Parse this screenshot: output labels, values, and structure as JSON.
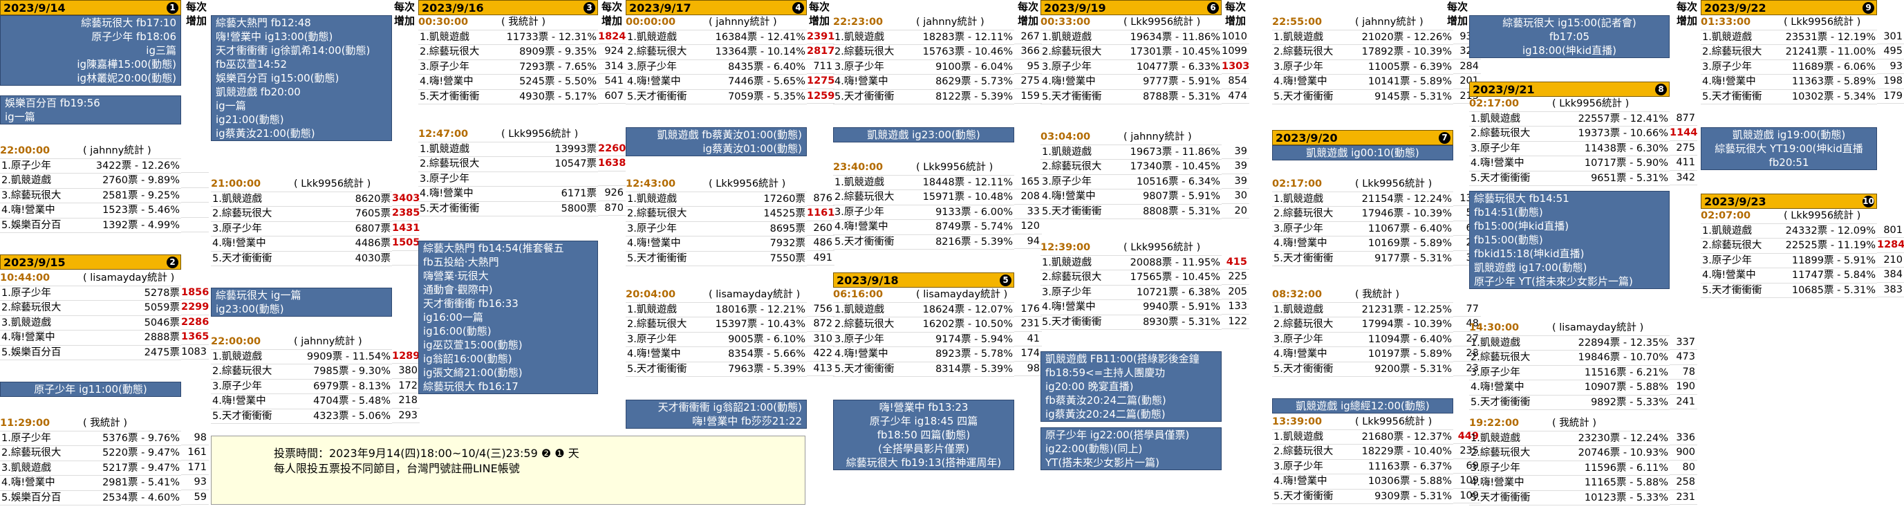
{
  "col_inc_header": "每次增加",
  "days": [
    {
      "date": "2023/9/14",
      "num": "1",
      "blue": [
        "綜藝玩很大 fb17:10",
        "原子少年 fb18:06",
        "ig三篇",
        "ig陳嘉樺15:00(動態)",
        "ig林叢妮20:00(動態)"
      ],
      "blue2": [
        "娛樂百分百 fb19:56",
        "ig一篇"
      ],
      "stats": [
        {
          "time": "22:00:00",
          "src": "( jahnny統計 )",
          "rows": [
            [
              "1.原子少年",
              "3422票 - 12.26%"
            ],
            [
              "2.凱競遊戲",
              "2760票 - 9.89%"
            ],
            [
              "3.綜藝玩很大",
              "2581票 - 9.25%"
            ],
            [
              "4.嗨!營業中",
              "1523票 - 5.46%"
            ],
            [
              "5.娛樂百分百",
              "1392票 - 4.99%"
            ]
          ],
          "inc": [
            "",
            "",
            "",
            "",
            ""
          ]
        }
      ]
    },
    {
      "date": "2023/9/15",
      "num": "2",
      "stats": [
        {
          "time": "10:44:00",
          "src": "( lisamayday統計 )",
          "rows": [
            [
              "1.原子少年",
              "5278票"
            ],
            [
              "2.綜藝玩很大",
              "5059票"
            ],
            [
              "3.凱競遊戲",
              "5046票"
            ],
            [
              "4.嗨!營業中",
              "2888票"
            ],
            [
              "5.娛樂百分百",
              "2475票"
            ]
          ],
          "inc": [
            "1856",
            "2299",
            "2286",
            "1365",
            "1083"
          ]
        },
        {
          "time": "11:29:00",
          "src": "( 我統計 )",
          "rows": [
            [
              "1.原子少年",
              "5376票 - 9.76%"
            ],
            [
              "2.綜藝玩很大",
              "5220票 - 9.47%"
            ],
            [
              "3.凱競遊戲",
              "5217票 - 9.47%"
            ],
            [
              "4.嗨!營業中",
              "2981票 - 5.41%"
            ],
            [
              "5.娛樂百分百",
              "2534票 - 4.60%"
            ]
          ],
          "inc": [
            "98",
            "161",
            "171",
            "93",
            "59"
          ]
        }
      ],
      "blue": [
        "綜藝玩很大 ig一篇",
        "ig23:00(動態)"
      ],
      "blue2": [
        "原子少年 ig11:00(動態)"
      ]
    }
  ],
  "col2": {
    "blue": [
      "綜藝大熱門 fb12:48",
      "嗨!營業中 ig13:00(動態)",
      "天才衝衝衝 ig徐凱希14:00(動態)",
      "fb巫苡萱14:52",
      "娛樂百分百 ig15:00(動態)",
      "凱競遊戲 fb20:00",
      "ig一篇",
      "ig21:00(動態)",
      "ig蔡黃汝21:00(動態)"
    ],
    "stats": [
      {
        "time": "21:00:00",
        "src": "( Lkk9956統計 )",
        "rows": [
          [
            "1.凱競遊戲",
            "8620票"
          ],
          [
            "2.綜藝玩很大",
            "7605票"
          ],
          [
            "3.原子少年",
            "6807票"
          ],
          [
            "4.嗨!營業中",
            "4486票"
          ],
          [
            "5.天才衝衝衝",
            "4030票"
          ]
        ],
        "inc": [
          "3403",
          "2385",
          "1431",
          "1505",
          ""
        ]
      },
      {
        "time": "22:00:00",
        "src": "( jahnny統計 )",
        "rows": [
          [
            "1.凱競遊戲",
            "9909票 - 11.54%"
          ],
          [
            "2.綜藝玩很大",
            "7985票 - 9.30%"
          ],
          [
            "3.原子少年",
            "6979票 - 8.13%"
          ],
          [
            "4.嗨!營業中",
            "4704票 - 5.48%"
          ],
          [
            "5.天才衝衝衝",
            "4323票 - 5.06%"
          ]
        ],
        "inc": [
          "1289",
          "380",
          "172",
          "218",
          "293"
        ]
      }
    ]
  },
  "day3": {
    "date": "2023/9/16",
    "num": "3",
    "stats": [
      {
        "time": "00:30:00",
        "src": "( 我統計 )",
        "rows": [
          [
            "1.凱競遊戲",
            "11733票 - 12.31%"
          ],
          [
            "2.綜藝玩很大",
            "8909票 - 9.35%"
          ],
          [
            "3.原子少年",
            "7293票 - 7.65%"
          ],
          [
            "4.嗨!營業中",
            "5245票 - 5.50%"
          ],
          [
            "5.天才衝衝衝",
            "4930票 - 5.17%"
          ]
        ],
        "inc": [
          "1824",
          "924",
          "314",
          "541",
          "607"
        ]
      },
      {
        "time": "12:47:00",
        "src": "( Lkk9956統計 )",
        "rows": [
          [
            "1.凱競遊戲",
            "13993票"
          ],
          [
            "2.綜藝玩很大",
            "10547票"
          ],
          [
            "3.原子少年",
            ""
          ],
          [
            "4.嗨!營業中",
            "6171票"
          ],
          [
            "5.天才衝衝衝",
            "5800票"
          ]
        ],
        "inc": [
          "2260",
          "1638",
          "",
          "926",
          "870"
        ]
      }
    ],
    "blue": [
      "綜藝大熱門 fb14:54(推套餐五",
      "fb五投給‧大熱門",
      "嗨營業‧玩很大",
      "通動會‧觀際中)",
      "天才衝衝衝 fb16:33",
      "ig16:00一篇",
      "ig16:00(動態)",
      "ig巫苡萱15:00(動態)",
      "ig翁韶16:00(動態)",
      "ig張文綺21:00(動態)",
      "綜藝玩很大 fb16:17"
    ]
  },
  "day4": {
    "date": "2023/9/17",
    "num": "4",
    "stats": [
      {
        "time": "00:00:00",
        "src": "( jahnny統計 )",
        "rows": [
          [
            "1.凱競遊戲",
            "16384票 - 12.41%"
          ],
          [
            "2.綜藝玩很大",
            "13364票 - 10.14%"
          ],
          [
            "3.原子少年",
            "8435票 - 6.40%"
          ],
          [
            "4.嗨!營業中",
            "7446票 - 5.65%"
          ],
          [
            "5.天才衝衝衝",
            "7059票 - 5.35%"
          ]
        ],
        "inc": [
          "2391",
          "2817",
          "711",
          "1275",
          "1259"
        ]
      },
      {
        "time": "12:43:00",
        "src": "( Lkk9956統計 )",
        "rows": [
          [
            "1.凱競遊戲",
            "17260票"
          ],
          [
            "2.綜藝玩很大",
            "14525票"
          ],
          [
            "3.原子少年",
            "8695票"
          ],
          [
            "4.嗨!營業中",
            "7932票"
          ],
          [
            "5.天才衝衝衝",
            "7550票"
          ]
        ],
        "inc": [
          "876",
          "1161",
          "260",
          "486",
          "491"
        ]
      },
      {
        "time": "20:04:00",
        "src": "( lisamayday統計 )",
        "rows": [
          [
            "1.凱競遊戲",
            "18016票 - 12.21%"
          ],
          [
            "2.綜藝玩很大",
            "15397票 - 10.43%"
          ],
          [
            "3.原子少年",
            "9005票 - 6.10%"
          ],
          [
            "4.嗨!營業中",
            "8354票 - 5.66%"
          ],
          [
            "5.天才衝衝衝",
            "7963票 - 5.39%"
          ]
        ],
        "inc": [
          "756",
          "872",
          "310",
          "422",
          "413"
        ]
      }
    ],
    "blue": [
      "凱競遊戲 fb蔡黃汝01:00(動態)",
      "ig蔡黃汝01:00(動態)"
    ],
    "blue2": [
      "天才衝衝衝 ig翁韶21:00(動態)",
      "嗨!營業中 fb莎莎21:22"
    ]
  },
  "day5": {
    "date": "2023/9/18",
    "num": "5",
    "stats": [
      {
        "time": "22:23:00",
        "src": "( jahnny統計 )",
        "rows": [
          [
            "1.凱競遊戲",
            "18283票 - 12.11%"
          ],
          [
            "2.綜藝玩很大",
            "15763票 - 10.46%"
          ],
          [
            "3.原子少年",
            "9100票 - 6.04%"
          ],
          [
            "4.嗨!營業中",
            "8629票 - 5.73%"
          ],
          [
            "5.天才衝衝衝",
            "8122票 - 5.39%"
          ]
        ],
        "inc": [
          "267",
          "366",
          "95",
          "275",
          "159"
        ]
      },
      {
        "time": "23:40:00",
        "src": "( Lkk9956統計 )",
        "rows": [
          [
            "1.凱競遊戲",
            "18448票 - 12.11%"
          ],
          [
            "2.綜藝玩很大",
            "15971票 - 10.48%"
          ],
          [
            "3.原子少年",
            "9133票 - 6.00%"
          ],
          [
            "4.嗨!營業中",
            "8749票 - 5.74%"
          ],
          [
            "5.天才衝衝衝",
            "8216票 - 5.39%"
          ]
        ],
        "inc": [
          "165",
          "208",
          "33",
          "120",
          "94"
        ]
      },
      {
        "time": "06:16:00",
        "src": "( lisamayday統計 )",
        "rows": [
          [
            "1.凱競遊戲",
            "18624票 - 12.07%"
          ],
          [
            "2.綜藝玩很大",
            "16202票 - 10.50%"
          ],
          [
            "3.原子少年",
            "9174票 - 5.94%"
          ],
          [
            "4.嗨!營業中",
            "8923票 - 5.78%"
          ],
          [
            "5.天才衝衝衝",
            "8314票 - 5.39%"
          ]
        ],
        "inc": [
          "176",
          "231",
          "41",
          "174",
          "98"
        ]
      }
    ],
    "blue": [
      "凱競遊戲 ig23:00(動態)"
    ],
    "blue2": [
      "嗨!營業中 fb13:23",
      "原子少年 ig18:45 四篇",
      "fb18:50 四篇(動態)",
      "(全搭學員影片僅票)",
      "綜藝玩很大 fb19:13(搭神運周年)"
    ]
  },
  "day6": {
    "date": "2023/9/19",
    "num": "6",
    "stats": [
      {
        "time": "00:33:00",
        "src": "( Lkk9956統計 )",
        "rows": [
          [
            "1.凱競遊戲",
            "19634票 - 11.86%"
          ],
          [
            "2.綜藝玩很大",
            "17301票 - 10.45%"
          ],
          [
            "3.原子少年",
            "10477票 - 6.33%"
          ],
          [
            "4.嗨!營業中",
            "9777票 - 5.91%"
          ],
          [
            "5.天才衝衝衝",
            "8788票 - 5.31%"
          ]
        ],
        "inc": [
          "1010",
          "1099",
          "1303",
          "854",
          "474"
        ]
      },
      {
        "time": "03:04:00",
        "src": "( jahnny統計 )",
        "rows": [
          [
            "1.凱競遊戲",
            "19673票 - 11.86%"
          ],
          [
            "2.綜藝玩很大",
            "17340票 - 10.45%"
          ],
          [
            "3.原子少年",
            "10516票 - 6.34%"
          ],
          [
            "4.嗨!營業中",
            "9807票 - 5.91%"
          ],
          [
            "5.天才衝衝衝",
            "8808票 - 5.31%"
          ]
        ],
        "inc": [
          "39",
          "39",
          "39",
          "30",
          "20"
        ]
      },
      {
        "time": "12:39:00",
        "src": "( Lkk9956統計 )",
        "rows": [
          [
            "1.凱競遊戲",
            "20088票 - 11.95%"
          ],
          [
            "2.綜藝玩很大",
            "17565票 - 10.45%"
          ],
          [
            "3.原子少年",
            "10721票 - 6.38%"
          ],
          [
            "4.嗨!營業中",
            "9940票 - 5.91%"
          ],
          [
            "5.天才衝衝衝",
            "8930票 - 5.31%"
          ]
        ],
        "inc": [
          "415",
          "225",
          "205",
          "133",
          "122"
        ]
      }
    ],
    "blue": [
      "凱競遊戲 FB11:00(搭綠影後金鐘",
      "fb18:59<=主持人團慶功",
      "ig20:00 晚宴直播)",
      "fb蔡黃汝20:24二篇(動態)",
      "ig蔡黃汝20:24二篇(動態)"
    ],
    "blue2": [
      "原子少年 ig22:00(搭學員僅票)",
      "ig22:00(動態)(同上)",
      "YT(搭未來少女影片一篇)"
    ]
  },
  "day7": {
    "date": "2023/9/20",
    "num": "7",
    "stats": [
      {
        "time": "22:55:00",
        "src": "( jahnny統計 )",
        "rows": [
          [
            "1.凱競遊戲",
            "21020票 - 12.26%"
          ],
          [
            "2.綜藝玩很大",
            "17892票 - 10.39%"
          ],
          [
            "3.原子少年",
            "11005票 - 6.39%"
          ],
          [
            "4.嗨!營業中",
            "10141票 - 5.89%"
          ],
          [
            "5.天才衝衝衝",
            "9145票 - 5.31%"
          ]
        ],
        "inc": [
          "932",
          "327",
          "284",
          "201",
          "215"
        ]
      },
      {
        "time": "02:17:00",
        "src": "( Lkk9956統計 )",
        "rows": [
          [
            "1.凱競遊戲",
            "21154票 - 12.24%"
          ],
          [
            "2.綜藝玩很大",
            "17946票 - 10.39%"
          ],
          [
            "3.原子少年",
            "11067票 - 6.40%"
          ],
          [
            "4.嗨!營業中",
            "10169票 - 5.89%"
          ],
          [
            "5.天才衝衝衝",
            "9177票 - 5.31%"
          ]
        ],
        "inc": [
          "134",
          "54",
          "62",
          "28",
          "32"
        ]
      },
      {
        "time": "08:32:00",
        "src": "( 我統計 )",
        "rows": [
          [
            "1.凱競遊戲",
            "21231票 - 12.25%"
          ],
          [
            "2.綜藝玩很大",
            "17994票 - 10.39%"
          ],
          [
            "3.原子少年",
            "11094票 - 6.40%"
          ],
          [
            "4.嗨!營業中",
            "10197票 - 5.89%"
          ],
          [
            "5.天才衝衝衝",
            "9200票 - 5.31%"
          ]
        ],
        "inc": [
          "77",
          "48",
          "27",
          "28",
          "23"
        ]
      },
      {
        "time": "13:39:00",
        "src": "( Lkk9956統計 )",
        "rows": [
          [
            "1.凱競遊戲",
            "21680票 - 12.37%"
          ],
          [
            "2.綜藝玩很大",
            "18229票 - 10.40%"
          ],
          [
            "3.原子少年",
            "11163票 - 6.37%"
          ],
          [
            "4.嗨!營業中",
            "10306票 - 5.88%"
          ],
          [
            "5.天才衝衝衝",
            "9309票 - 5.31%"
          ]
        ],
        "inc": [
          "449",
          "235",
          "69",
          "109",
          "109"
        ]
      }
    ],
    "blue": [
      "凱競遊戲 ig00:10(動態)"
    ],
    "blue2": [
      "凱競遊戲 ig總經12:00(動態)"
    ]
  },
  "day8": {
    "date": "2023/9/21",
    "num": "8",
    "blue_top": [
      "綜藝玩很大 ig15:00(記者會)",
      "fb17:05",
      "ig18:00(坤kid直播)"
    ],
    "stats": [
      {
        "time": "02:17:00",
        "src": "( Lkk9956統計 )",
        "rows": [
          [
            "1.凱競遊戲",
            "22557票 - 12.41%"
          ],
          [
            "2.綜藝玩很大",
            "19373票 - 10.66%"
          ],
          [
            "3.原子少年",
            "11438票 - 6.30%"
          ],
          [
            "4.嗨!營業中",
            "10717票 - 5.90%"
          ],
          [
            "5.天才衝衝衝",
            "9651票 - 5.31%"
          ]
        ],
        "inc": [
          "877",
          "1144",
          "275",
          "411",
          "342"
        ]
      },
      {
        "time": "14:30:00",
        "src": "( lisamayday統計 )",
        "rows": [
          [
            "1.凱競遊戲",
            "22894票 - 12.35%"
          ],
          [
            "2.綜藝玩很大",
            "19846票 - 10.70%"
          ],
          [
            "3.原子少年",
            "11516票 - 6.21%"
          ],
          [
            "4.嗨!營業中",
            "10907票 - 5.88%"
          ],
          [
            "5.天才衝衝衝",
            "9892票 - 5.33%"
          ]
        ],
        "inc": [
          "337",
          "473",
          "78",
          "190",
          "241"
        ]
      },
      {
        "time": "19:22:00",
        "src": "( 我統計 )",
        "rows": [
          [
            "1.凱競遊戲",
            "23230票 - 12.24%"
          ],
          [
            "2.綜藝玩很大",
            "20746票 - 10.93%"
          ],
          [
            "3.原子少年",
            "11596票 - 6.11%"
          ],
          [
            "4.嗨!營業中",
            "11165票 - 5.88%"
          ],
          [
            "5.天才衝衝衝",
            "10123票 - 5.33%"
          ]
        ],
        "inc": [
          "336",
          "900",
          "80",
          "258",
          "231"
        ]
      }
    ],
    "blue": [
      "綜藝玩很大 fb14:51",
      "fb14:51(動態)",
      "fb15:00(坤kid直播)",
      "fb15:00(動態)",
      "fbkid15:18(坤kid直播)",
      "凱競遊戲 ig17:00(動態)",
      "原子少年 YT(搭未來少女影片一篇)"
    ]
  },
  "day9": {
    "date": "2023/9/22",
    "num": "9",
    "stats": [
      {
        "time": "01:33:00",
        "src": "( Lkk9956統計 )",
        "rows": [
          [
            "1.凱競遊戲",
            "23531票 - 12.19%"
          ],
          [
            "2.綜藝玩很大",
            "21241票 - 11.00%"
          ],
          [
            "3.原子少年",
            "11689票 - 6.06%"
          ],
          [
            "4.嗨!營業中",
            "11363票 - 5.89%"
          ],
          [
            "5.天才衝衝衝",
            "10302票 - 5.34%"
          ]
        ],
        "inc": [
          "301",
          "495",
          "93",
          "198",
          "179"
        ]
      }
    ],
    "blue": [
      "凱競遊戲 ig19:00(動態)",
      "綜藝玩很大 YT19:00(坤kid直播",
      "fb20:51"
    ]
  },
  "day10": {
    "date": "2023/9/23",
    "num": "10",
    "stats": [
      {
        "time": "02:07:00",
        "src": "( Lkk9956統計 )",
        "rows": [
          [
            "1.凱競遊戲",
            "24332票 - 12.09%"
          ],
          [
            "2.綜藝玩很大",
            "22525票 - 11.19%"
          ],
          [
            "3.原子少年",
            "11899票 - 5.91%"
          ],
          [
            "4.嗨!營業中",
            "11747票 - 5.84%"
          ],
          [
            "5.天才衝衝衝",
            "10685票 - 5.31%"
          ]
        ],
        "inc": [
          "801",
          "1284",
          "210",
          "384",
          "383"
        ]
      }
    ]
  },
  "vote": {
    "line1": "投票時間：2023年9月14(四)18:00~10/4(三)23:59 ❷ ❶ 天",
    "line2": "每人限投五票投不同節目，台灣門號註冊LINE帳號"
  },
  "colors": {
    "date_bg": "#f4b400",
    "blue_bg": "#4d6f9e",
    "time_color": "#b36b00",
    "inc_red": "#c00000"
  }
}
